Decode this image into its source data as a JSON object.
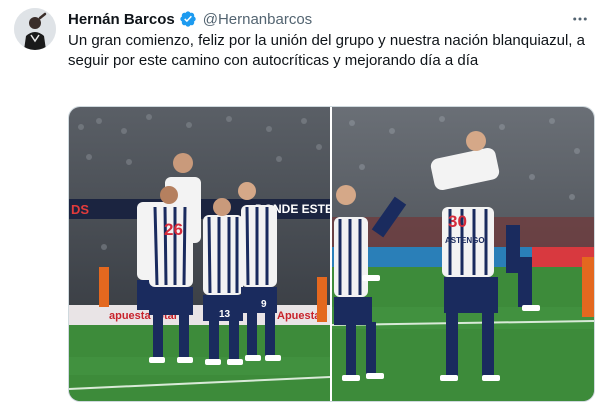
{
  "author": {
    "name": "Hernán Barcos",
    "handle": "@Hernanbarcos",
    "verified": true
  },
  "tweet": {
    "text": "Un gran comienzo, feliz por la unión del grupo y nuestra nación blanquiazul, a seguir por este camino con autocríticas y mejorando día a día"
  },
  "photos": [
    {
      "banner_left": "DS",
      "banner_right": "DONDE ESTE",
      "board_text": "apuesta total",
      "board_text2": "Apuesta",
      "jersey_number": "26",
      "jersey_number_2": "13",
      "jersey_number_3": "9"
    },
    {
      "jersey_number": "30",
      "jersey_name": "ASTENGO"
    }
  ],
  "colors": {
    "verified_blue": "#1d9bf0",
    "alianza_navy": "#1a2b5e",
    "alianza_white": "#f3f3f3",
    "pitch_green": "#3d8b3a",
    "rival_orange": "#e4681f"
  },
  "icons": [
    "verified-badge-icon",
    "more-options-icon"
  ]
}
